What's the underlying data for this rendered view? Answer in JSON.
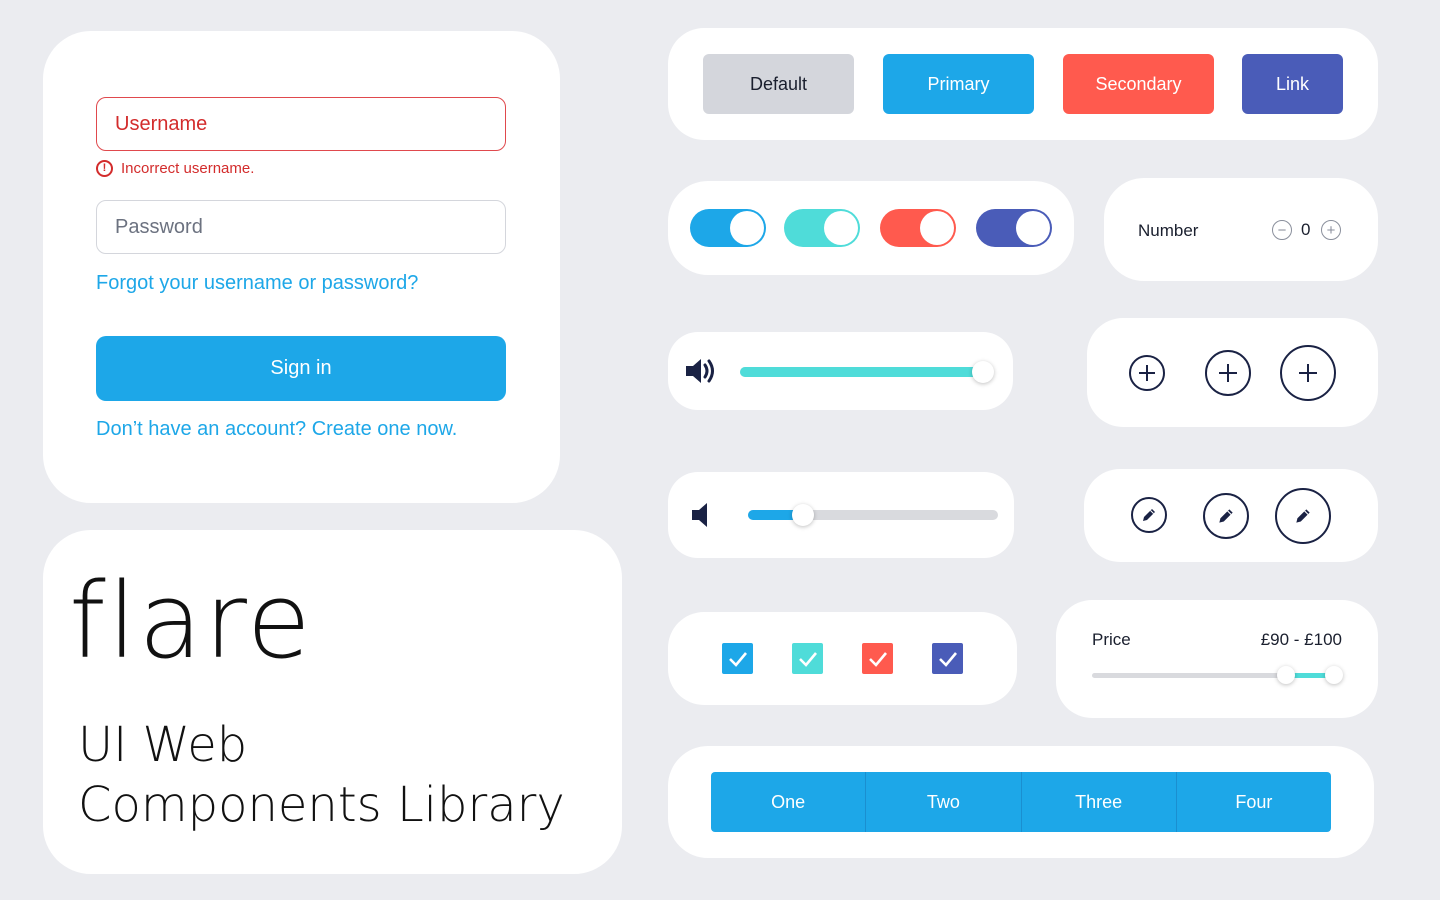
{
  "colors": {
    "blue": "#1da7e8",
    "teal": "#4fdcd9",
    "red": "#ff5a4e",
    "indigo": "#4a5cb8",
    "grey": "#d4d6dc",
    "navy": "#1a2244",
    "error": "#d32c2c"
  },
  "login": {
    "username_placeholder": "Username",
    "error_message": "Incorrect username.",
    "error_icon": "!",
    "password_placeholder": "Password",
    "forgot_link": "Forgot your username or password?",
    "signin_label": "Sign in",
    "create_account_link": "Don’t have an account? Create one now."
  },
  "brand": {
    "logo": "flare",
    "subtitle_line1": "UI Web",
    "subtitle_line2": "Components Library"
  },
  "buttons": {
    "default_label": "Default",
    "primary_label": "Primary",
    "secondary_label": "Secondary",
    "link_label": "Link"
  },
  "toggles": [
    {
      "color": "blue",
      "on": true
    },
    {
      "color": "teal",
      "on": true
    },
    {
      "color": "red",
      "on": true
    },
    {
      "color": "indigo",
      "on": true
    }
  ],
  "number": {
    "label": "Number",
    "value": "0",
    "minus_icon": "−",
    "plus_icon": "+"
  },
  "volume_high": {
    "icon": "volume-high-icon",
    "level": 0.97
  },
  "volume_low": {
    "icon": "volume-low-icon",
    "level": 0.22
  },
  "checkboxes": [
    {
      "color": "blue",
      "checked": true
    },
    {
      "color": "teal",
      "checked": true
    },
    {
      "color": "red",
      "checked": true
    },
    {
      "color": "indigo",
      "checked": true
    }
  ],
  "price": {
    "label": "Price",
    "range": "£90 - £100",
    "low_fraction": 0.8,
    "high_fraction": 1.0
  },
  "tabs": [
    "One",
    "Two",
    "Three",
    "Four"
  ]
}
